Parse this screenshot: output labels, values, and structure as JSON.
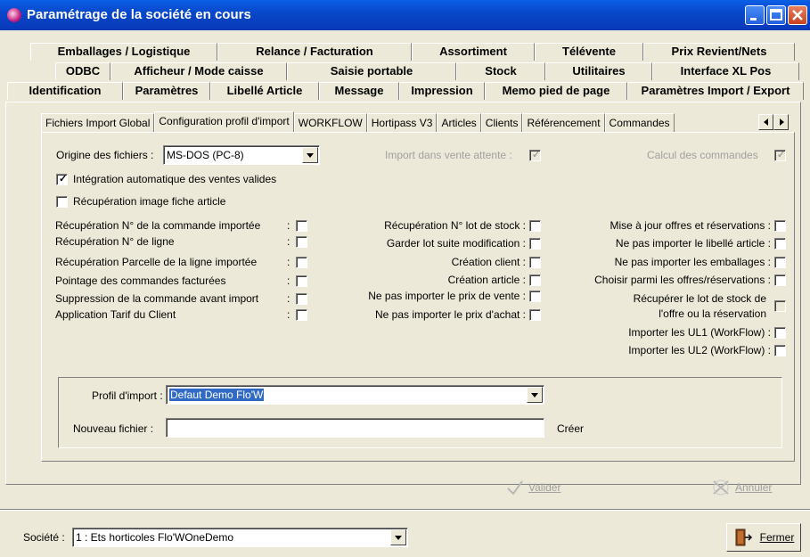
{
  "window": {
    "title": "Paramétrage de la société en cours"
  },
  "main_tabs": {
    "row1": [
      "Emballages / Logistique",
      "Relance / Facturation",
      "Assortiment",
      "Télévente",
      "Prix Revient/Nets"
    ],
    "row2": [
      "ODBC",
      "Afficheur / Mode caisse",
      "Saisie portable",
      "Stock",
      "Utilitaires",
      "Interface XL Pos"
    ],
    "row3": [
      "Identification",
      "Paramètres",
      "Libellé Article",
      "Message",
      "Impression",
      "Memo pied de page",
      "Paramètres Import / Export"
    ]
  },
  "sub_tabs": [
    "Fichiers Import Global",
    "Configuration profil d'import",
    "WORKFLOW",
    "Hortipass V3",
    "Articles",
    "Clients",
    "Référencement",
    "Commandes"
  ],
  "form": {
    "origine_label": "Origine des fichiers :",
    "origine_value": "MS-DOS (PC-8)",
    "import_vente_label": "Import dans vente attente :",
    "calcul_commandes_label": "Calcul des commandes",
    "integration_label": "Intégration automatique des ventes valides",
    "recup_image_label": "Récupération image fiche article",
    "col1": [
      "Récupération N° de la commande importée",
      "Récupération N° de ligne",
      "Récupération Parcelle de la ligne importée",
      "Pointage des commandes facturées",
      "Suppression de la commande avant import",
      "Application Tarif du Client"
    ],
    "col2": [
      "Récupération N° lot de stock :",
      "Garder lot suite modification :",
      "Création client :",
      "Création article :",
      "Ne pas importer le prix de vente :",
      "Ne pas importer le prix d'achat :"
    ],
    "col3": [
      "Mise à jour offres et réservations :",
      "Ne pas importer le libellé article :",
      "Ne pas importer les emballages :",
      "Choisir parmi les offres/réservations :",
      "Récupérer le lot de stock de",
      "l'offre ou la réservation",
      "Importer les UL1 (WorkFlow) :",
      "Importer les UL2 (WorkFlow) :"
    ],
    "profil_label": "Profil d'import :",
    "profil_value": "Defaut Demo Flo'W",
    "nouveau_label": "Nouveau fichier :",
    "nouveau_value": "",
    "creer_label": "Créer"
  },
  "actions": {
    "valider": "Valider",
    "annuler": "Annuler",
    "fermer": "Fermer"
  },
  "footer": {
    "societe_label": "Société :",
    "societe_value": "1 : Ets horticoles Flo'WOneDemo"
  }
}
